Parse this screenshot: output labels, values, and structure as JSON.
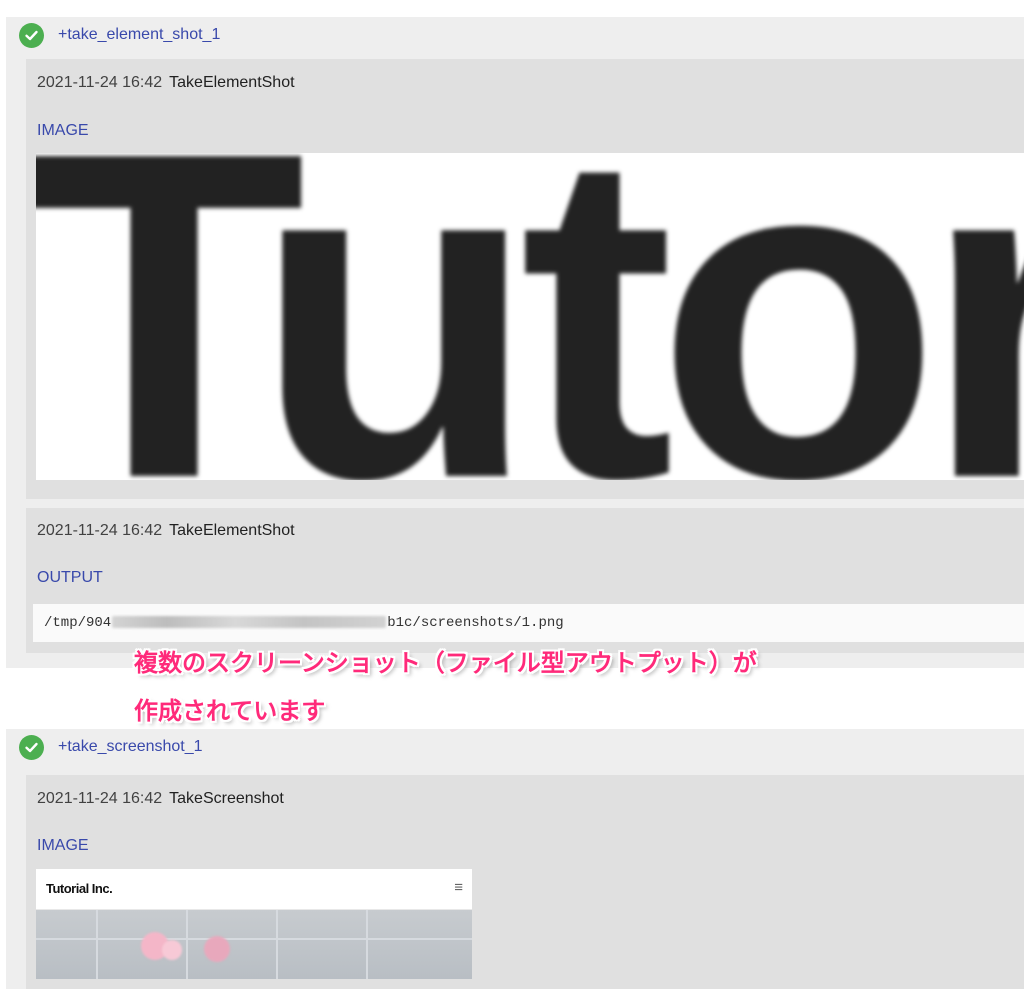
{
  "steps": [
    {
      "name": "+take_element_shot_1",
      "entries": [
        {
          "timestamp": "2021-11-24 16:42",
          "kind": "TakeElementShot",
          "type": "IMAGE",
          "image_text": "Tutori"
        },
        {
          "timestamp": "2021-11-24 16:42",
          "kind": "TakeElementShot",
          "type": "OUTPUT",
          "output_prefix": "/tmp/904",
          "output_suffix": "b1c/screenshots/1.png"
        }
      ]
    },
    {
      "name": "+take_screenshot_1",
      "entries": [
        {
          "timestamp": "2021-11-24 16:42",
          "kind": "TakeScreenshot",
          "type": "IMAGE",
          "thumbnail": {
            "site_title": "Tutorial Inc.",
            "menu_glyph": "≡"
          }
        }
      ]
    }
  ],
  "annotation": {
    "line1": "複数のスクリーンショット（ファイル型アウトプット）が",
    "line2": "作成されています",
    "color": "#ff2a7a"
  },
  "colors": {
    "link": "#3949ab",
    "success": "#4caf50",
    "step_bg": "#eeeeee",
    "entry_bg": "#e0e0e0"
  },
  "icons": {
    "status": "check-circle-icon",
    "menu": "hamburger-menu-icon"
  }
}
